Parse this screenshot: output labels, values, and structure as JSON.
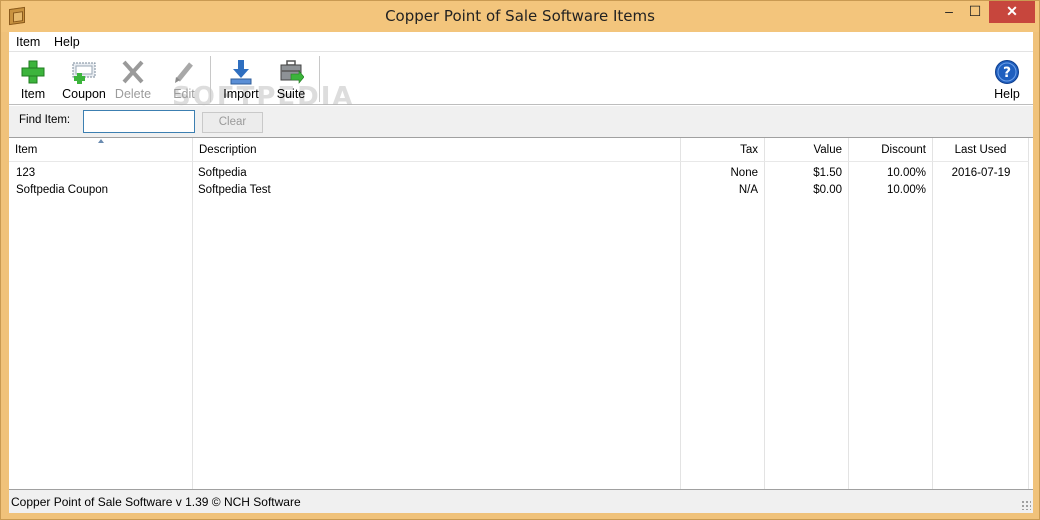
{
  "window": {
    "title": "Copper Point of Sale Software Items",
    "min_glyph": "–",
    "max_glyph": "☐",
    "close_glyph": "✕"
  },
  "menu": [
    "Item",
    "Help"
  ],
  "toolbar": {
    "watermark": "SOFTPEDIA",
    "buttons": [
      {
        "label": "Item",
        "icon": "add-item-icon",
        "enabled": true
      },
      {
        "label": "Coupon",
        "icon": "coupon-icon",
        "enabled": true
      },
      {
        "label": "Delete",
        "icon": "delete-icon",
        "enabled": false
      },
      {
        "label": "Edit",
        "icon": "edit-icon",
        "enabled": false
      },
      {
        "label": "Import",
        "icon": "import-icon",
        "enabled": true
      },
      {
        "label": "Suite",
        "icon": "suite-icon",
        "enabled": true
      }
    ],
    "help": {
      "label": "Help",
      "icon": "help-icon"
    }
  },
  "find": {
    "label": "Find Item:",
    "value": "",
    "placeholder": "",
    "clear_label": "Clear"
  },
  "table": {
    "columns": [
      "Item",
      "Description",
      "Tax",
      "Value",
      "Discount",
      "Last Used"
    ],
    "sorted_column": "Item",
    "rows": [
      {
        "item": "123",
        "description": "Softpedia",
        "tax": "None",
        "value": "$1.50",
        "discount": "10.00%",
        "last_used": "2016-07-19"
      },
      {
        "item": "Softpedia Coupon",
        "description": "Softpedia Test",
        "tax": "N/A",
        "value": "$0.00",
        "discount": "10.00%",
        "last_used": ""
      }
    ]
  },
  "status": {
    "text": "Copper Point of Sale Software v 1.39 © NCH Software"
  },
  "colors": {
    "frame": "#f0c27a",
    "accent_green": "#3cb43c",
    "accent_blue": "#2f6fc0",
    "close_red": "#c7463d"
  }
}
